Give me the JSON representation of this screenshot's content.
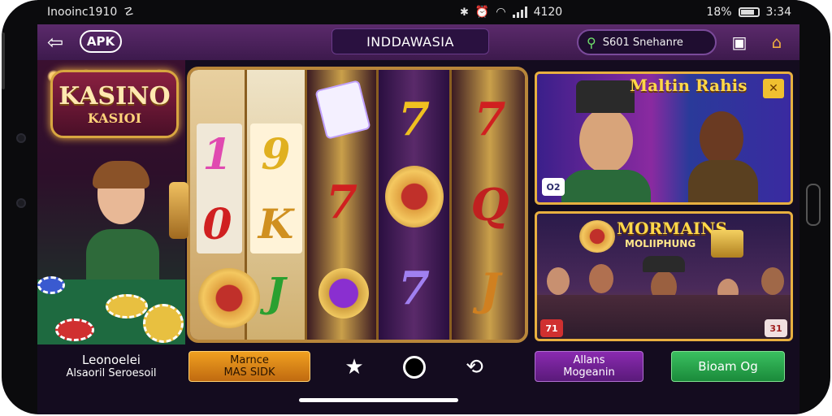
{
  "status": {
    "carrier": "Inooinc1910",
    "time_center": "4120",
    "battery_text": "18%",
    "time_right": "3:34"
  },
  "topbar": {
    "apk_label": "APK",
    "title": "INDDAWASIA",
    "search_placeholder": "S601 Snehanre"
  },
  "left_panel": {
    "logo_line1": "KASINO",
    "logo_line2": "KASIOI",
    "caption_line1": "Leonoelei",
    "caption_line2": "Alsaoril Seroesoil"
  },
  "slot": {
    "symbols": {
      "r1_top": "1",
      "r1_mid": "0",
      "r2_top": "9",
      "r2_mid": "K",
      "r2_bot": "J",
      "r3_mid": "7",
      "r4_top": "7",
      "r4_bot": "7",
      "r5_top": "7",
      "r5_mid": "Q",
      "r5_bot": "J"
    }
  },
  "cards": {
    "card1_title": "Maltin Rahis",
    "card1_tag": "O2",
    "card2_title": "MORMAINS",
    "card2_sub": "MOLIIPHUNG",
    "card2_tag_left": "71",
    "card2_tag_right": "31"
  },
  "buttons": {
    "orange_line1": "Marnce",
    "orange_line2": "MAS SIDK",
    "purple_line1": "Allans",
    "purple_line2": "Mogeanin",
    "green_label": "Bioam Og"
  },
  "icons": {
    "nav": [
      "star-icon",
      "circle-icon",
      "refresh-icon"
    ]
  }
}
